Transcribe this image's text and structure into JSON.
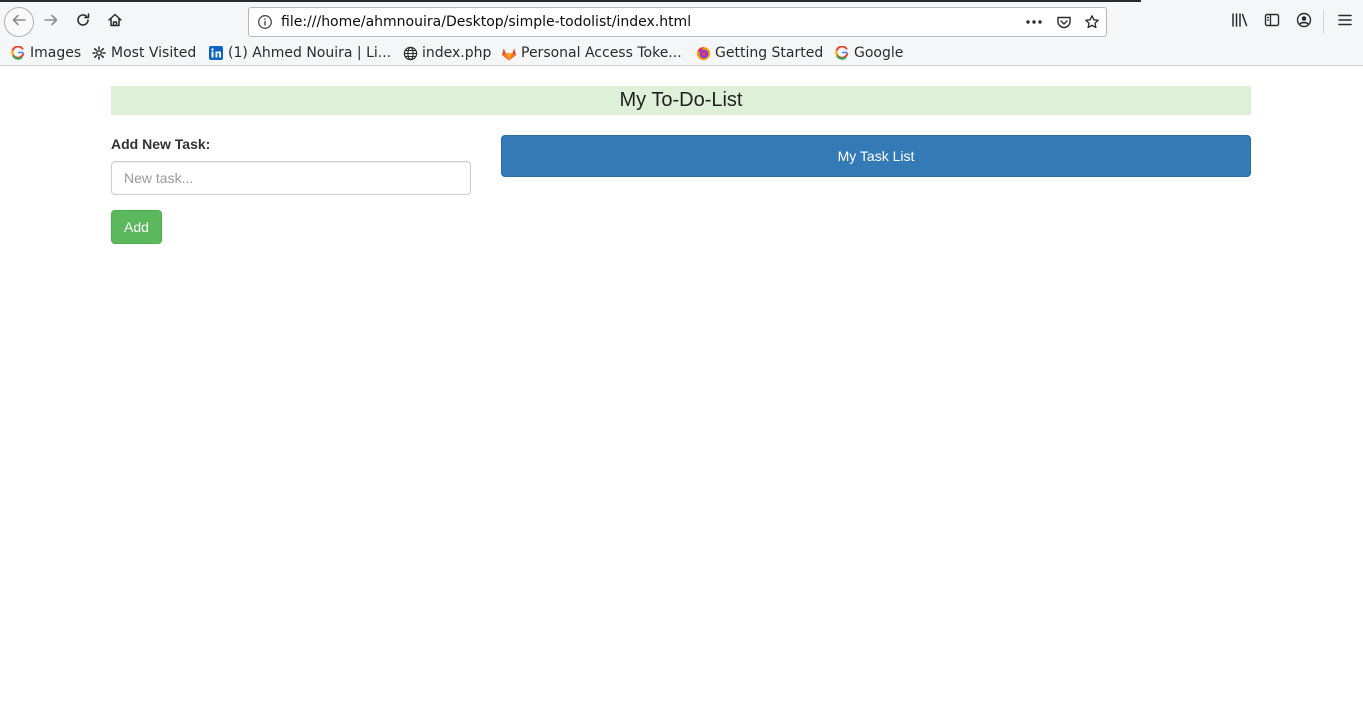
{
  "browser": {
    "url": "file:///home/ahmnouira/Desktop/simple-todolist/index.html",
    "nav_icons": {
      "back": "arrow-left-icon",
      "forward": "arrow-right-icon",
      "reload": "reload-icon",
      "home": "home-icon"
    },
    "url_icons": {
      "info": "info-icon",
      "more": "more-horizontal-icon",
      "pocket": "pocket-icon",
      "bookmark": "star-icon"
    },
    "toolbar_icons": {
      "library": "library-icon",
      "sidebar": "sidebar-icon",
      "account": "account-icon",
      "menu": "hamburger-menu-icon"
    },
    "bookmarks": [
      {
        "label": "Images",
        "icon": "google-icon"
      },
      {
        "label": "Most Visited",
        "icon": "gear-icon"
      },
      {
        "label": "(1) Ahmed Nouira | Li...",
        "icon": "linkedin-icon"
      },
      {
        "label": "index.php",
        "icon": "globe-icon"
      },
      {
        "label": "Personal Access Toke...",
        "icon": "gitlab-icon"
      },
      {
        "label": "Getting Started",
        "icon": "firefox-icon"
      },
      {
        "label": "Google",
        "icon": "google-icon"
      }
    ]
  },
  "page": {
    "title": "My To-Do-List",
    "add_task_label": "Add New Task:",
    "task_input_placeholder": "New task...",
    "task_input_value": "",
    "add_button_label": "Add",
    "task_list_heading": "My Task List"
  },
  "colors": {
    "header_bg": "#dff0d8",
    "add_button_bg": "#5cb85c",
    "task_list_bg": "#337ab7"
  }
}
